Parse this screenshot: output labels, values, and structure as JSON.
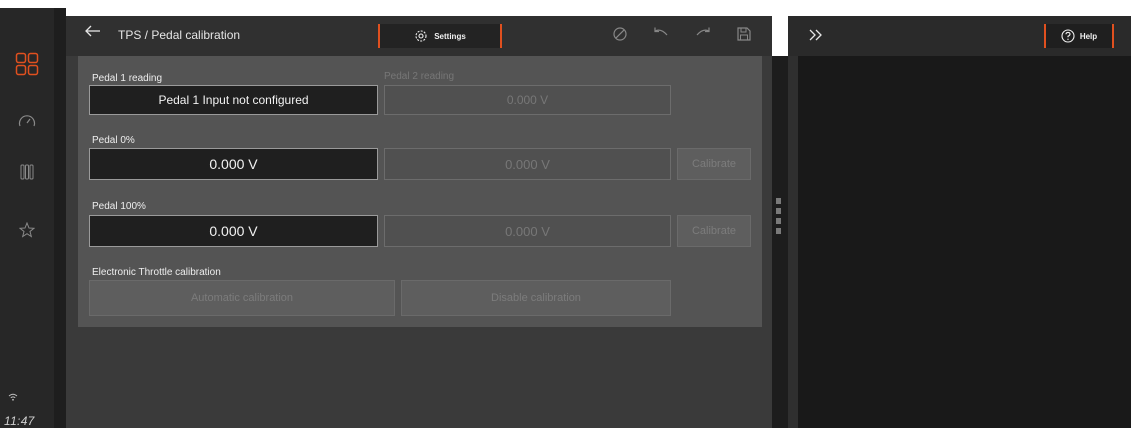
{
  "header": {
    "title": "TPS / Pedal calibration",
    "settings_label": "Settings"
  },
  "sidebar": {
    "items": [
      {
        "icon": "dashboard-grid-icon",
        "active": true
      },
      {
        "icon": "gauge-icon"
      },
      {
        "icon": "columns-icon"
      },
      {
        "icon": "star-icon"
      }
    ],
    "clock": "11:47",
    "status_icon": "wifi-icon"
  },
  "pedal": {
    "reading_label_1": "Pedal 1 reading",
    "reading_label_2": "Pedal 2 reading",
    "reading_value_1": "Pedal 1 Input not configured",
    "reading_value_2": "0.000 V",
    "zero_label": "Pedal 0%",
    "zero_value_1": "0.000 V",
    "zero_value_2": "0.000 V",
    "full_label": "Pedal 100%",
    "full_value_1": "0.000 V",
    "full_value_2": "0.000 V",
    "calibrate_label": "Calibrate"
  },
  "throttle": {
    "section_label": "Electronic Throttle calibration",
    "auto_label": "Automatic calibration",
    "disable_label": "Disable calibration"
  },
  "help": {
    "label": "Help"
  },
  "colors": {
    "accent": "#e0501f",
    "background": "#3a3a3a",
    "card": "#545454",
    "field": "#1f1f1f"
  }
}
